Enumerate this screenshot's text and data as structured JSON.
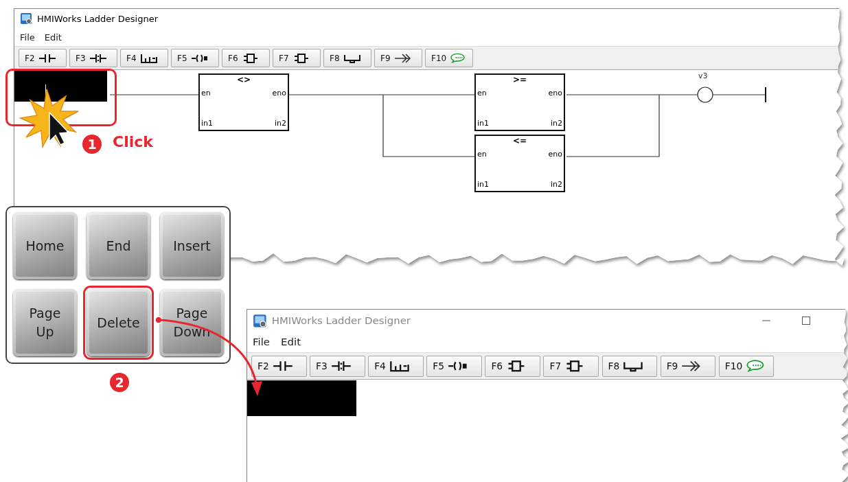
{
  "windows": [
    {
      "title": "HMIWorks Ladder Designer",
      "active": true,
      "window_buttons": false,
      "menu": [
        "File",
        "Edit"
      ],
      "toolbar": [
        {
          "key": "F2",
          "kind": "contact"
        },
        {
          "key": "F3",
          "kind": "contact_parallel"
        },
        {
          "key": "F4",
          "kind": "branch"
        },
        {
          "key": "F5",
          "kind": "coil"
        },
        {
          "key": "F6",
          "kind": "block"
        },
        {
          "key": "F7",
          "kind": "block"
        },
        {
          "key": "F8",
          "kind": "branch_down"
        },
        {
          "key": "F9",
          "kind": "jump"
        },
        {
          "key": "F10",
          "kind": "comment"
        }
      ],
      "diagram": {
        "selection": true,
        "blocks": [
          {
            "operator": "<>",
            "inputs": [
              "en",
              "in1"
            ],
            "outputs": [
              "eno",
              "in2"
            ]
          },
          {
            "operator": ">=",
            "inputs": [
              "en",
              "in1"
            ],
            "outputs": [
              "eno",
              "in2"
            ]
          },
          {
            "operator": "<=",
            "inputs": [
              "en",
              "in1"
            ],
            "outputs": [
              "eno",
              "in2"
            ]
          }
        ],
        "coil": {
          "label": "v3"
        }
      }
    },
    {
      "title": "HMIWorks Ladder Designer",
      "active": false,
      "window_buttons": true,
      "menu": [
        "File",
        "Edit"
      ],
      "toolbar": [
        {
          "key": "F2",
          "kind": "contact"
        },
        {
          "key": "F3",
          "kind": "contact_parallel"
        },
        {
          "key": "F4",
          "kind": "branch"
        },
        {
          "key": "F5",
          "kind": "coil"
        },
        {
          "key": "F6",
          "kind": "block"
        },
        {
          "key": "F7",
          "kind": "block"
        },
        {
          "key": "F8",
          "kind": "branch_down"
        },
        {
          "key": "F9",
          "kind": "jump"
        },
        {
          "key": "F10",
          "kind": "comment"
        }
      ],
      "diagram": {
        "selection": true
      }
    }
  ],
  "keyboard": [
    {
      "label": "Home",
      "selected": false
    },
    {
      "label": "End",
      "selected": false
    },
    {
      "label": "Insert",
      "selected": false
    },
    {
      "label": "Page Up",
      "selected": false
    },
    {
      "label": "Delete",
      "selected": true
    },
    {
      "label": "Page Down",
      "selected": false
    }
  ],
  "steps": [
    {
      "number": "1",
      "caption": "Click"
    },
    {
      "number": "2"
    }
  ]
}
